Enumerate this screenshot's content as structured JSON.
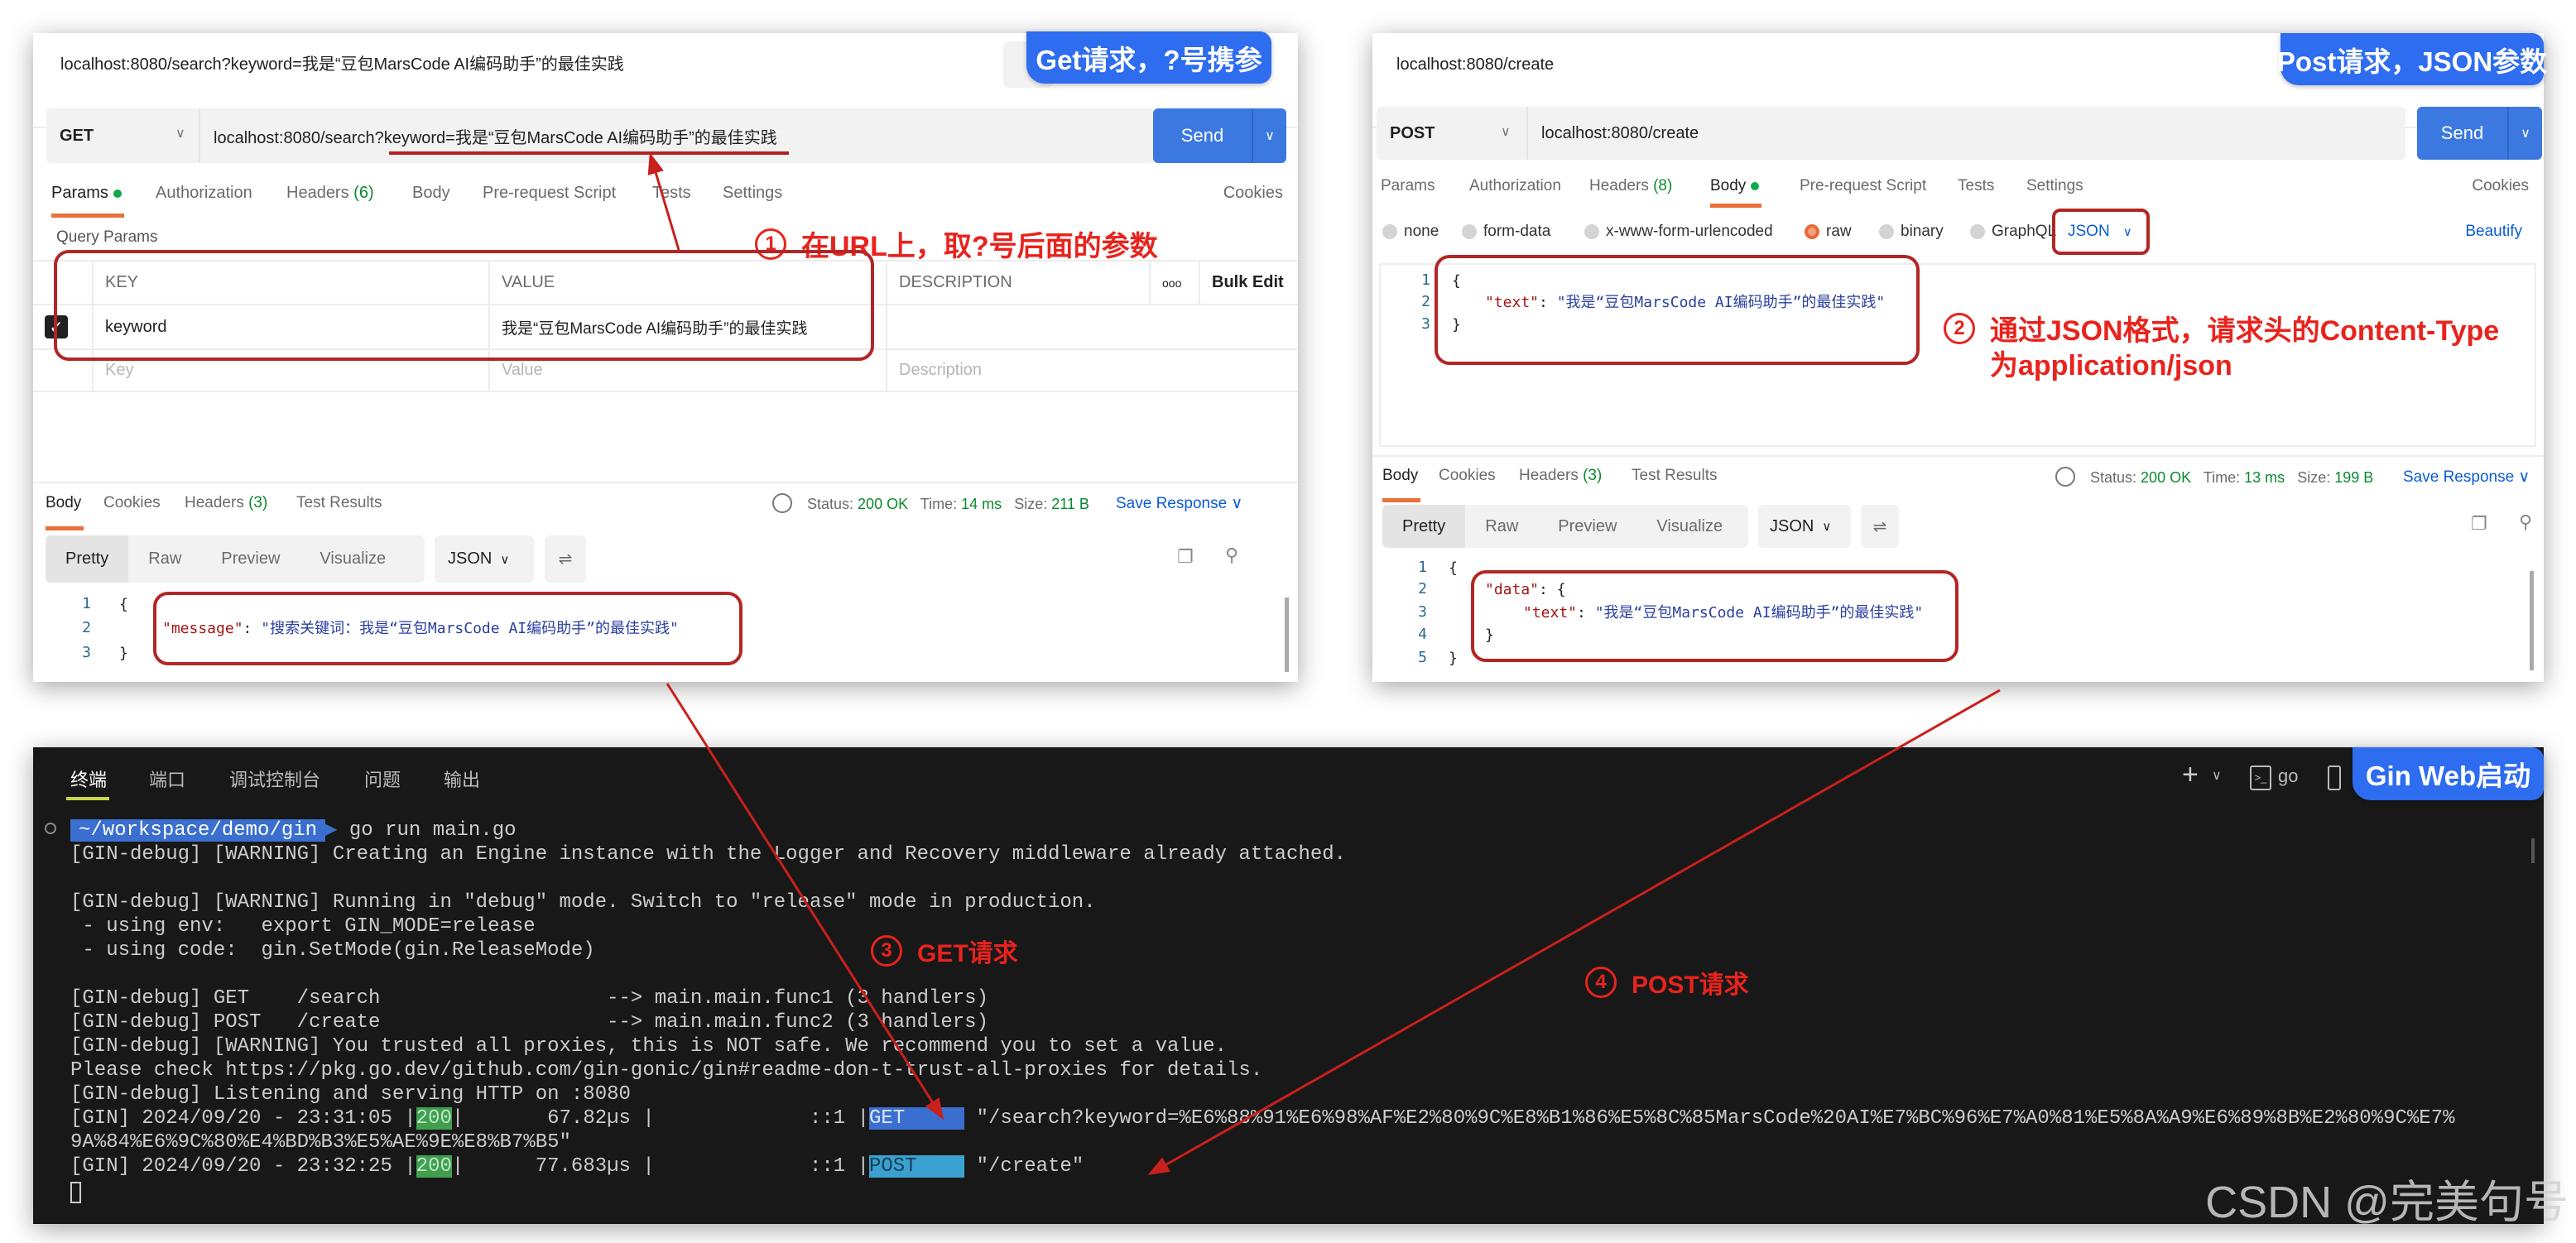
{
  "get_panel": {
    "title": "localhost:8080/search?keyword=我是“豆包MarsCode AI编码助手”的最佳实践",
    "badge": "Get请求，?号携参",
    "method": "GET",
    "url": "localhost:8080/search?keyword=我是“豆包MarsCode AI编码助手”的最佳实践",
    "send": "Send",
    "tabs": [
      {
        "label": "Params"
      },
      {
        "label": "Authorization"
      },
      {
        "label": "Headers",
        "count": "(6)"
      },
      {
        "label": "Body"
      },
      {
        "label": "Pre-request Script"
      },
      {
        "label": "Tests"
      },
      {
        "label": "Settings"
      }
    ],
    "cookies": "Cookies",
    "query_params": "Query Params",
    "table": {
      "headers": [
        "KEY",
        "VALUE",
        "DESCRIPTION",
        "ooo",
        "Bulk Edit"
      ],
      "row": {
        "checked": true,
        "key": "keyword",
        "value": "我是“豆包MarsCode AI编码助手”的最佳实践"
      },
      "placeholders": {
        "key": "Key",
        "value": "Value",
        "description": "Description"
      }
    },
    "response": {
      "tabs": [
        {
          "label": "Body"
        },
        {
          "label": "Cookies"
        },
        {
          "label": "Headers",
          "count": "(3)"
        },
        {
          "label": "Test Results"
        }
      ],
      "status_label": "Status:",
      "status": "200 OK",
      "time_label": "Time:",
      "time": "14 ms",
      "size_label": "Size:",
      "size": "211 B",
      "save_response": "Save Response",
      "views": [
        "Pretty",
        "Raw",
        "Preview",
        "Visualize"
      ],
      "format": "JSON",
      "line_numbers": [
        "1",
        "2",
        "3"
      ],
      "lines": {
        "open": "{",
        "key": "\"message\"",
        "colon": ": ",
        "value": "\"搜索关键词：我是“豆包MarsCode AI编码助手”的最佳实践\"",
        "close": "}"
      }
    }
  },
  "post_panel": {
    "title": "localhost:8080/create",
    "badge": "Post请求，JSON参数",
    "method": "POST",
    "url": "localhost:8080/create",
    "send": "Send",
    "tabs": [
      {
        "label": "Params"
      },
      {
        "label": "Authorization"
      },
      {
        "label": "Headers",
        "count": "(8)"
      },
      {
        "label": "Body"
      },
      {
        "label": "Pre-request Script"
      },
      {
        "label": "Tests"
      },
      {
        "label": "Settings"
      }
    ],
    "cookies": "Cookies",
    "body_types": [
      "none",
      "form-data",
      "x-www-form-urlencoded",
      "raw",
      "binary",
      "GraphQL"
    ],
    "body_type_selected": "raw",
    "raw_format": "JSON",
    "beautify": "Beautify",
    "request_body": {
      "line_numbers": [
        "1",
        "2",
        "3"
      ],
      "open": "{",
      "key": "\"text\"",
      "colon": ": ",
      "value": "\"我是“豆包MarsCode AI编码助手”的最佳实践\"",
      "close": "}"
    },
    "response": {
      "tabs": [
        {
          "label": "Body"
        },
        {
          "label": "Cookies"
        },
        {
          "label": "Headers",
          "count": "(3)"
        },
        {
          "label": "Test Results"
        }
      ],
      "status_label": "Status:",
      "status": "200 OK",
      "time_label": "Time:",
      "time": "13 ms",
      "size_label": "Size:",
      "size": "199 B",
      "save_response": "Save Response",
      "views": [
        "Pretty",
        "Raw",
        "Preview",
        "Visualize"
      ],
      "format": "JSON",
      "line_numbers": [
        "1",
        "2",
        "3",
        "4",
        "5"
      ],
      "lines": {
        "open": "{",
        "data_key": "\"data\"",
        "data_open": ": {",
        "key": "\"text\"",
        "colon": ": ",
        "value": "\"我是“豆包MarsCode AI编码助手”的最佳实践\"",
        "inner_close": "}",
        "close": "}"
      }
    }
  },
  "terminal": {
    "tabs": [
      "终端",
      "端口",
      "调试控制台",
      "问题",
      "输出"
    ],
    "shell": "go",
    "badge": "Gin Web启动",
    "prompt_path": "~/workspace/demo/gin",
    "command": "go run main.go",
    "lines": [
      "[GIN-debug] [WARNING] Creating an Engine instance with the Logger and Recovery middleware already attached.",
      "",
      "[GIN-debug] [WARNING] Running in \"debug\" mode. Switch to \"release\" mode in production.",
      " - using env:   export GIN_MODE=release",
      " - using code:  gin.SetMode(gin.ReleaseMode)",
      "",
      "[GIN-debug] GET    /search                   --> main.main.func1 (3 handlers)",
      "[GIN-debug] POST   /create                   --> main.main.func2 (3 handlers)",
      "[GIN-debug] [WARNING] You trusted all proxies, this is NOT safe. We recommend you to set a value.",
      "Please check https://pkg.go.dev/github.com/gin-gonic/gin#readme-don-t-trust-all-proxies for details.",
      "[GIN-debug] Listening and serving HTTP on :8080"
    ],
    "log_get": {
      "prefix": "[GIN] 2024/09/20 - 23:31:05 |",
      "status": "200",
      "mid": "|       67.82µs |             ::1 |",
      "method": "GET     ",
      "path": " \"/search?keyword=%E6%88%91%E6%98%AF%E2%80%9C%E8%B1%86%E5%8C%85MarsCode%20AI%E7%BC%96%E7%A0%81%E5%8A%A9%E6%89%8B%E2%80%9C%E7%",
      "path_wrap": "9A%84%E6%9C%80%E4%BD%B3%E5%AE%9E%E8%B7%B5\""
    },
    "log_post": {
      "prefix": "[GIN] 2024/09/20 - 23:32:25 |",
      "status": "200",
      "mid": "|      77.683µs |             ::1 |",
      "method": "POST    ",
      "path": " \"/create\""
    }
  },
  "annotations": {
    "a1": {
      "num": "1",
      "text": "在URL上，取?号后面的参数"
    },
    "a2": {
      "num": "2",
      "text": "通过JSON格式，请求头的Content-Type",
      "text2": "为application/json"
    },
    "a3": {
      "num": "3",
      "text": "GET请求"
    },
    "a4": {
      "num": "4",
      "text": "POST请求"
    }
  },
  "watermark": "CSDN @完美句号",
  "colors": {
    "accent": "#2e6cf0",
    "send": "#3b79e0",
    "annotation": "#e8231d",
    "highlight_box": "#b32626",
    "tab_underline": "#e8703a",
    "terminal_bg": "#181818"
  }
}
